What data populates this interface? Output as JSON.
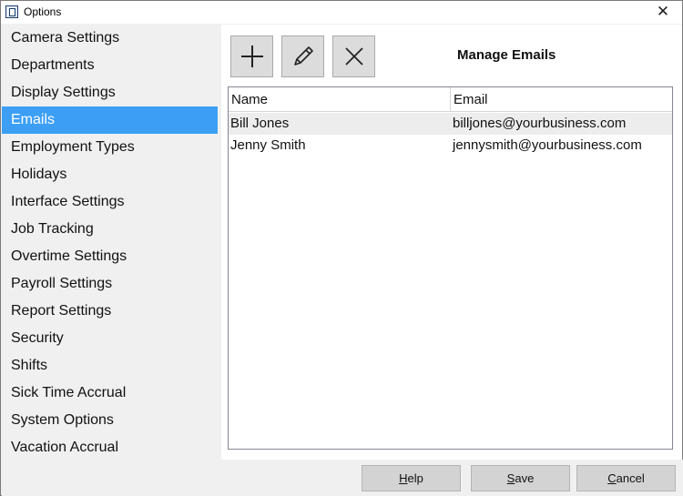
{
  "window": {
    "title": "Options",
    "close_glyph": "✕"
  },
  "sidebar": {
    "selected_index": 3,
    "items": [
      {
        "label": "Camera Settings"
      },
      {
        "label": "Departments"
      },
      {
        "label": "Display Settings"
      },
      {
        "label": "Emails"
      },
      {
        "label": "Employment Types"
      },
      {
        "label": "Holidays"
      },
      {
        "label": "Interface Settings"
      },
      {
        "label": "Job Tracking"
      },
      {
        "label": "Overtime Settings"
      },
      {
        "label": "Payroll Settings"
      },
      {
        "label": "Report Settings"
      },
      {
        "label": "Security"
      },
      {
        "label": "Shifts"
      },
      {
        "label": "Sick Time Accrual"
      },
      {
        "label": "System Options"
      },
      {
        "label": "Vacation Accrual"
      }
    ]
  },
  "toolbar": {
    "add_icon": "plus-icon",
    "edit_icon": "pencil-icon",
    "delete_icon": "x-icon"
  },
  "main": {
    "title": "Manage Emails"
  },
  "grid": {
    "columns": [
      "Name",
      "Email"
    ],
    "rows": [
      {
        "name": "Bill Jones",
        "email": "billjones@yourbusiness.com"
      },
      {
        "name": "Jenny Smith",
        "email": "jennysmith@yourbusiness.com"
      }
    ]
  },
  "footer": {
    "help": {
      "mnemonic": "H",
      "rest": "elp"
    },
    "save": {
      "mnemonic": "S",
      "rest": "ave"
    },
    "cancel": {
      "mnemonic": "C",
      "rest": "ancel"
    }
  },
  "colors": {
    "selection": "#3c9ff5",
    "button_face": "#dcdcdc",
    "panel": "#f0f0f0"
  }
}
